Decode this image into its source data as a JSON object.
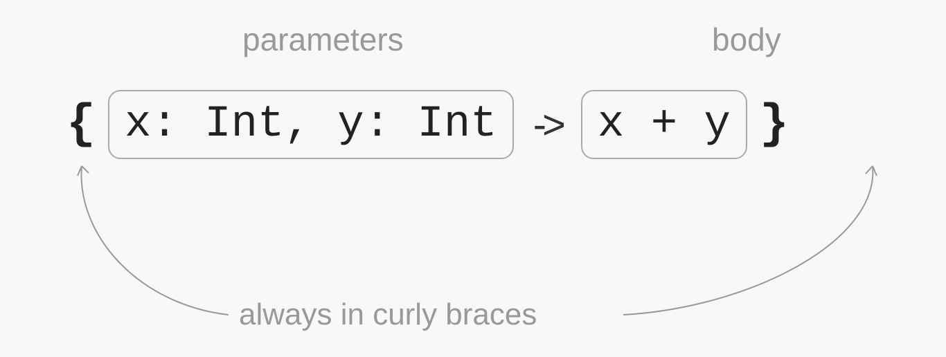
{
  "labels": {
    "parameters": "parameters",
    "body": "body",
    "braces": "always in curly braces"
  },
  "code": {
    "open_brace": "{",
    "parameters_box": "x: Int, y: Int",
    "arrow": "->",
    "body_box": "x + y",
    "close_brace": "}"
  }
}
